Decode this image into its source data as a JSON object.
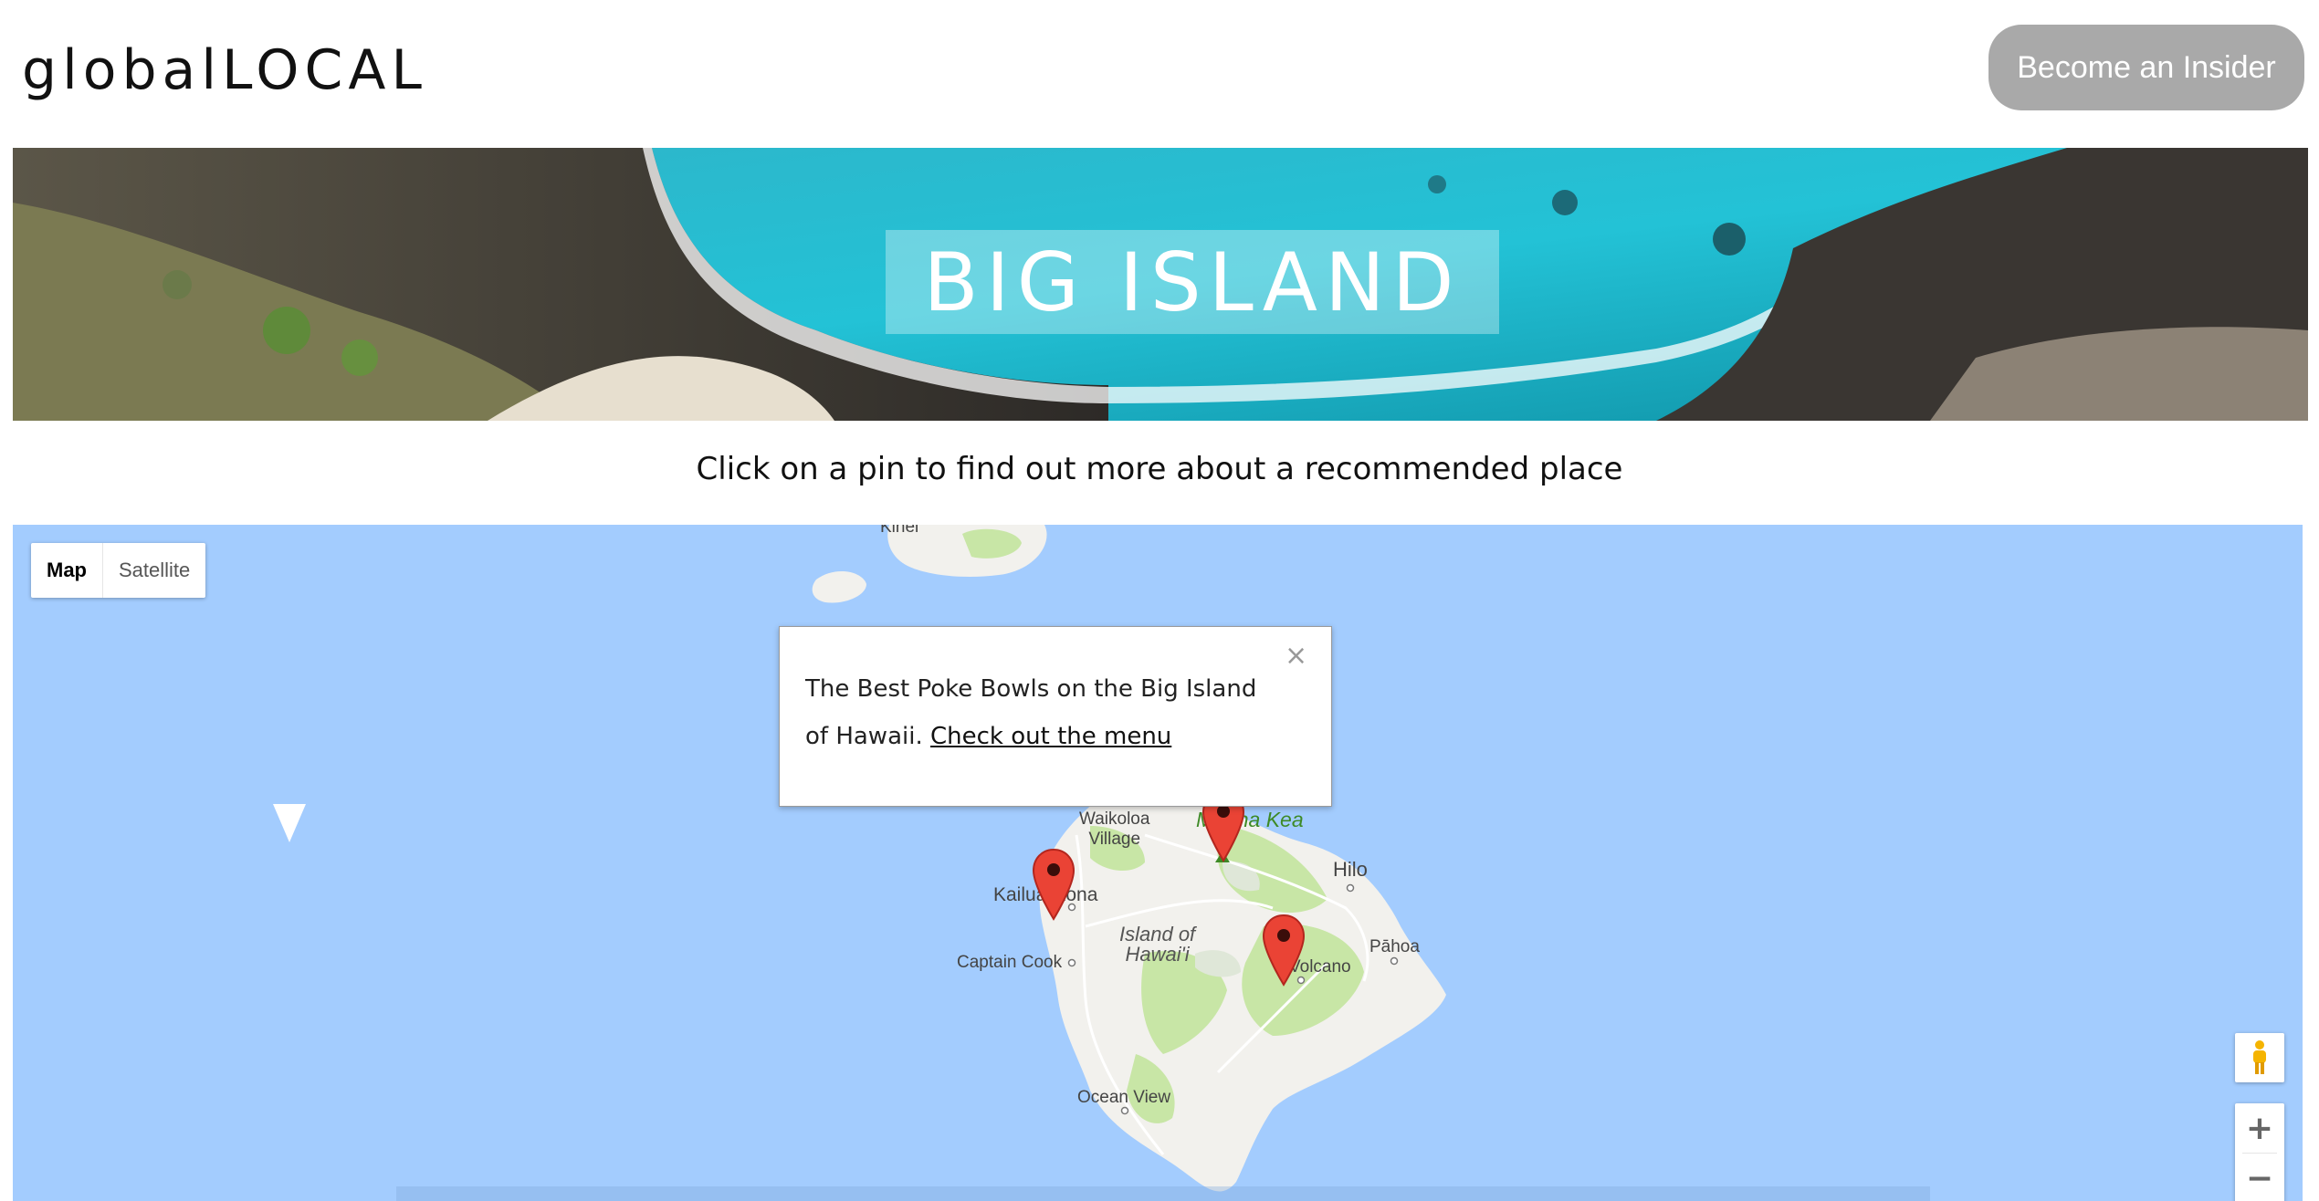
{
  "header": {
    "logo": "globalLOCAL",
    "insider_button": "Become an Insider"
  },
  "hero": {
    "title": "BIG ISLAND"
  },
  "instruction": "Click on a pin to find out more about a recommended place",
  "map": {
    "type_controls": {
      "map_label": "Map",
      "satellite_label": "Satellite",
      "selected": "Map"
    },
    "places": {
      "kihei": "Kihei",
      "waikoloa": "Waikoloa\nVillage",
      "mauna_kea": "Mauna Kea",
      "hilo": "Hilo",
      "kailua_kona": "Kailua-Kona",
      "island": "Island of\nHawai'i",
      "pahoa": "Pāhoa",
      "volcano": "Volcano",
      "captain_cook": "Captain Cook",
      "ocean_view": "Ocean View"
    },
    "popup": {
      "text": "The Best Poke Bowls on the Big Island of Hawaii. ",
      "link": "Check out the menu",
      "close": "×"
    },
    "zoom_in": "+",
    "zoom_out": "−"
  },
  "colors": {
    "ocean": "#a3ccfe",
    "land": "#f2f1ed",
    "park": "#c8e6a6",
    "pin": "#ea4335",
    "button": "#a9a9a9"
  }
}
